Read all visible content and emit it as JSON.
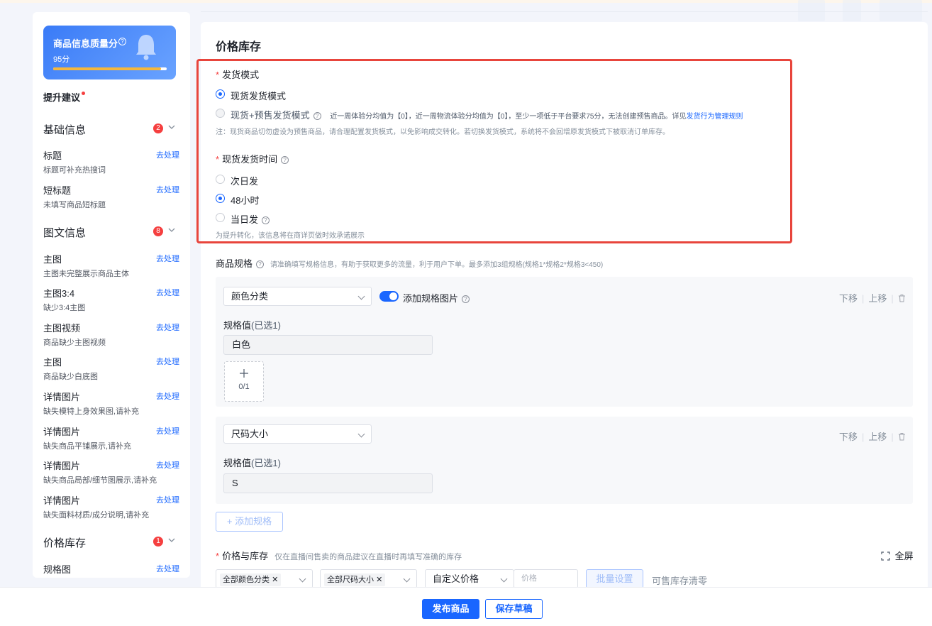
{
  "sidebar": {
    "score_title": "商品信息质量分",
    "score_value": "95分",
    "score_progress": 0.95,
    "suggest": "提升建议",
    "sections": [
      {
        "title": "基础信息",
        "badge": "2"
      },
      {
        "title": "图文信息",
        "badge": "8"
      },
      {
        "title": "价格库存",
        "badge": "1"
      }
    ],
    "items": [
      {
        "name": "标题",
        "link": "去处理",
        "desc": "标题可补充热搜词"
      },
      {
        "name": "短标题",
        "link": "去处理",
        "desc": "未填写商品短标题"
      },
      {
        "name": "主图",
        "link": "去处理",
        "desc": "主图未完整展示商品主体"
      },
      {
        "name": "主图3:4",
        "link": "去处理",
        "desc": "缺少3:4主图"
      },
      {
        "name": "主图视频",
        "link": "去处理",
        "desc": "商品缺少主图视频"
      },
      {
        "name": "主图",
        "link": "去处理",
        "desc": "商品缺少白底图"
      },
      {
        "name": "详情图片",
        "link": "去处理",
        "desc": "缺失模特上身效果图,请补充"
      },
      {
        "name": "详情图片",
        "link": "去处理",
        "desc": "缺失商品平铺展示,请补充"
      },
      {
        "name": "详情图片",
        "link": "去处理",
        "desc": "缺失商品局部/细节图展示,请补充"
      },
      {
        "name": "详情图片",
        "link": "去处理",
        "desc": "缺失面料材质/成分说明,请补充"
      },
      {
        "name": "规格图",
        "link": "去处理",
        "desc": ""
      }
    ]
  },
  "main": {
    "title": "价格库存",
    "ship_mode": {
      "label": "发货模式",
      "opt1": "现货发货模式",
      "opt2": "现货+预售发货模式",
      "opt2_hint": "近一周体验分均值为【0】，近一周物流体验分均值为【0】，至少一项低于平台要求75分，无法创建预售商品。详见",
      "opt2_link": "发货行为管理规则",
      "note": "注：现货商品切勿虚设为预售商品，请合理配置发货模式，以免影响成交转化。若切换发货模式，系统将不会回增原发货模式下被取消订单库存。"
    },
    "ship_time": {
      "label": "现货发货时间",
      "opt1": "次日发",
      "opt2": "48小时",
      "opt3": "当日发",
      "note": "为提升转化，该信息将在商详页做时效承诺展示"
    },
    "spec": {
      "label": "商品规格",
      "hint": "请准确填写规格信息，有助于获取更多的流量，利于用户下单。最多添加3组规格(规格1*规格2*规格3<450)",
      "group1_select": "颜色分类",
      "add_image_label": "添加规格图片",
      "values_label": "规格值",
      "values_count": "(已选1)",
      "group1_value": "白色",
      "upload_count": "0/1",
      "group2_select": "尺码大小",
      "group2_value": "S",
      "move_down": "下移",
      "move_up": "上移",
      "add_spec": "添加规格"
    },
    "price": {
      "label": "价格与库存",
      "hint": "仅在直播间售卖的商品建议在直播时再填写准确的库存",
      "fullscreen": "全屏",
      "filter1": "全部颜色分类",
      "filter2": "全部尺码大小",
      "price_type": "自定义价格",
      "price_placeholder": "价格",
      "batch": "批量设置",
      "clear": "可售库存清零"
    }
  },
  "footer": {
    "publish": "发布商品",
    "save": "保存草稿"
  }
}
